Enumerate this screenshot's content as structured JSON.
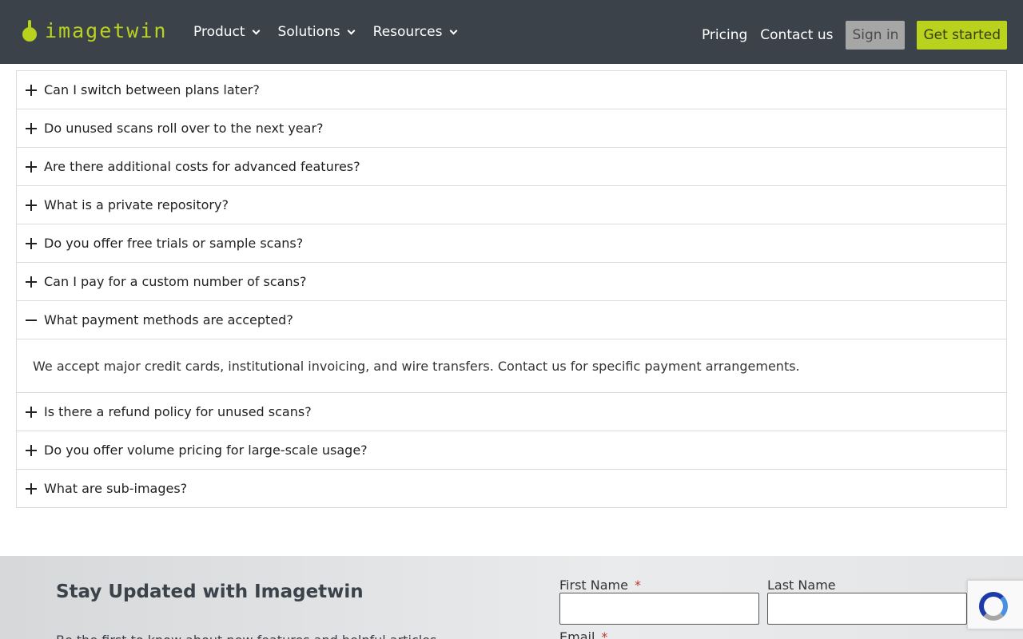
{
  "header": {
    "logo_text": "imagetwin",
    "nav": [
      "Product",
      "Solutions",
      "Resources"
    ],
    "pricing": "Pricing",
    "contact": "Contact us",
    "sign_in": "Sign in",
    "get_started": "Get started"
  },
  "faq": {
    "items": [
      "Can I switch between plans later?",
      "Do unused scans roll over to the next year?",
      "Are there additional costs for advanced features?",
      "What is a private repository?",
      "Do you offer free trials or sample scans?",
      "Can I pay for a custom number of scans?",
      "What payment methods are accepted?",
      "Is there a refund policy for unused scans?",
      "Do you offer volume pricing for large-scale usage?",
      "What are sub-images?"
    ],
    "expanded_index": 6,
    "answer": "We accept major credit cards, institutional invoicing, and wire transfers. Contact us for specific payment arrangements."
  },
  "newsletter": {
    "title": "Stay Updated with Imagetwin",
    "subtitle": "Be the first to know about new features and helpful articles",
    "first_name_label": "First Name",
    "last_name_label": "Last Name",
    "email_label": "Email",
    "required_mark": "*"
  },
  "colors": {
    "header_bg": "#3c424a",
    "accent": "#b9d21d"
  }
}
